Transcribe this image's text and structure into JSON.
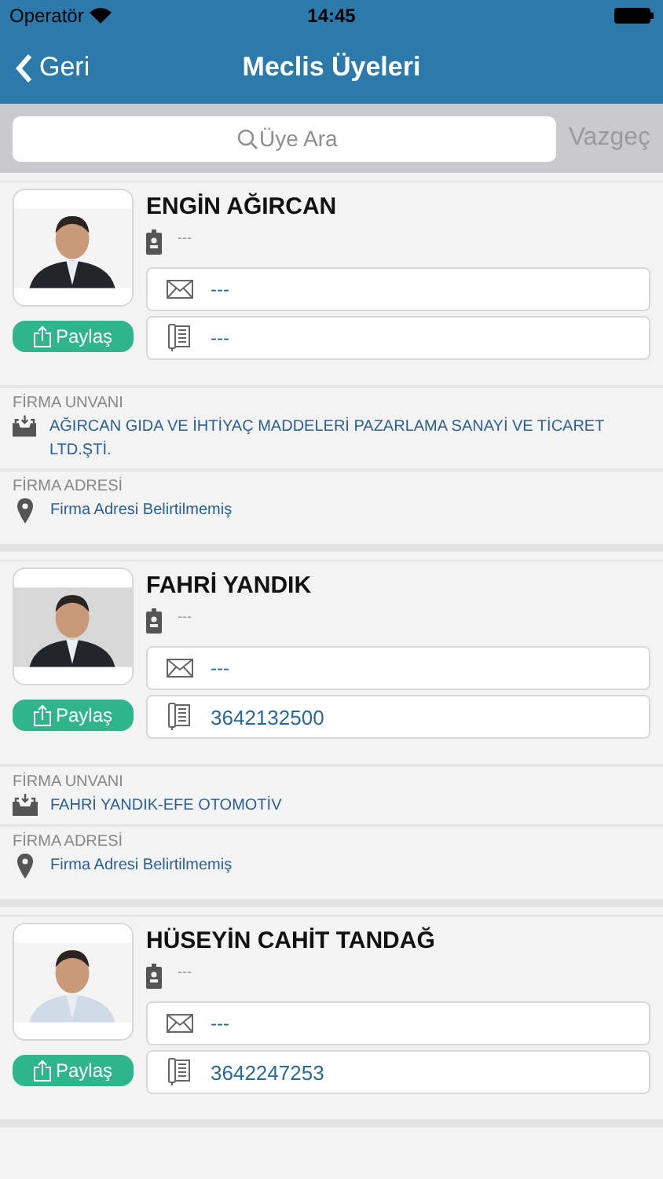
{
  "status_bar": {
    "carrier": "Operatör",
    "time": "14:45"
  },
  "nav": {
    "back": "Geri",
    "title": "Meclis Üyeleri"
  },
  "search": {
    "placeholder": "Üye Ara",
    "cancel": "Vazgeç"
  },
  "members": [
    {
      "name": "ENGİN AĞIRCAN",
      "title": "---",
      "email": "---",
      "phone": "---",
      "share": "Paylaş",
      "company_label": "FİRMA UNVANI",
      "company": "AĞIRCAN GIDA VE İHTİYAÇ MADDELERİ PAZARLAMA SANAYİ VE TİCARET LTD.ŞTİ.",
      "address_label": "FİRMA ADRESİ",
      "address": "Firma Adresi Belirtilmemiş"
    },
    {
      "name": "FAHRİ YANDIK",
      "title": "---",
      "email": "---",
      "phone": "3642132500",
      "share": "Paylaş",
      "company_label": "FİRMA UNVANI",
      "company": "FAHRİ YANDIK-EFE OTOMOTİV",
      "address_label": "FİRMA ADRESİ",
      "address": "Firma Adresi Belirtilmemiş"
    },
    {
      "name": "HÜSEYİN CAHİT TANDAĞ",
      "title": "---",
      "email": "---",
      "phone": "3642247253",
      "share": "Paylaş"
    }
  ]
}
